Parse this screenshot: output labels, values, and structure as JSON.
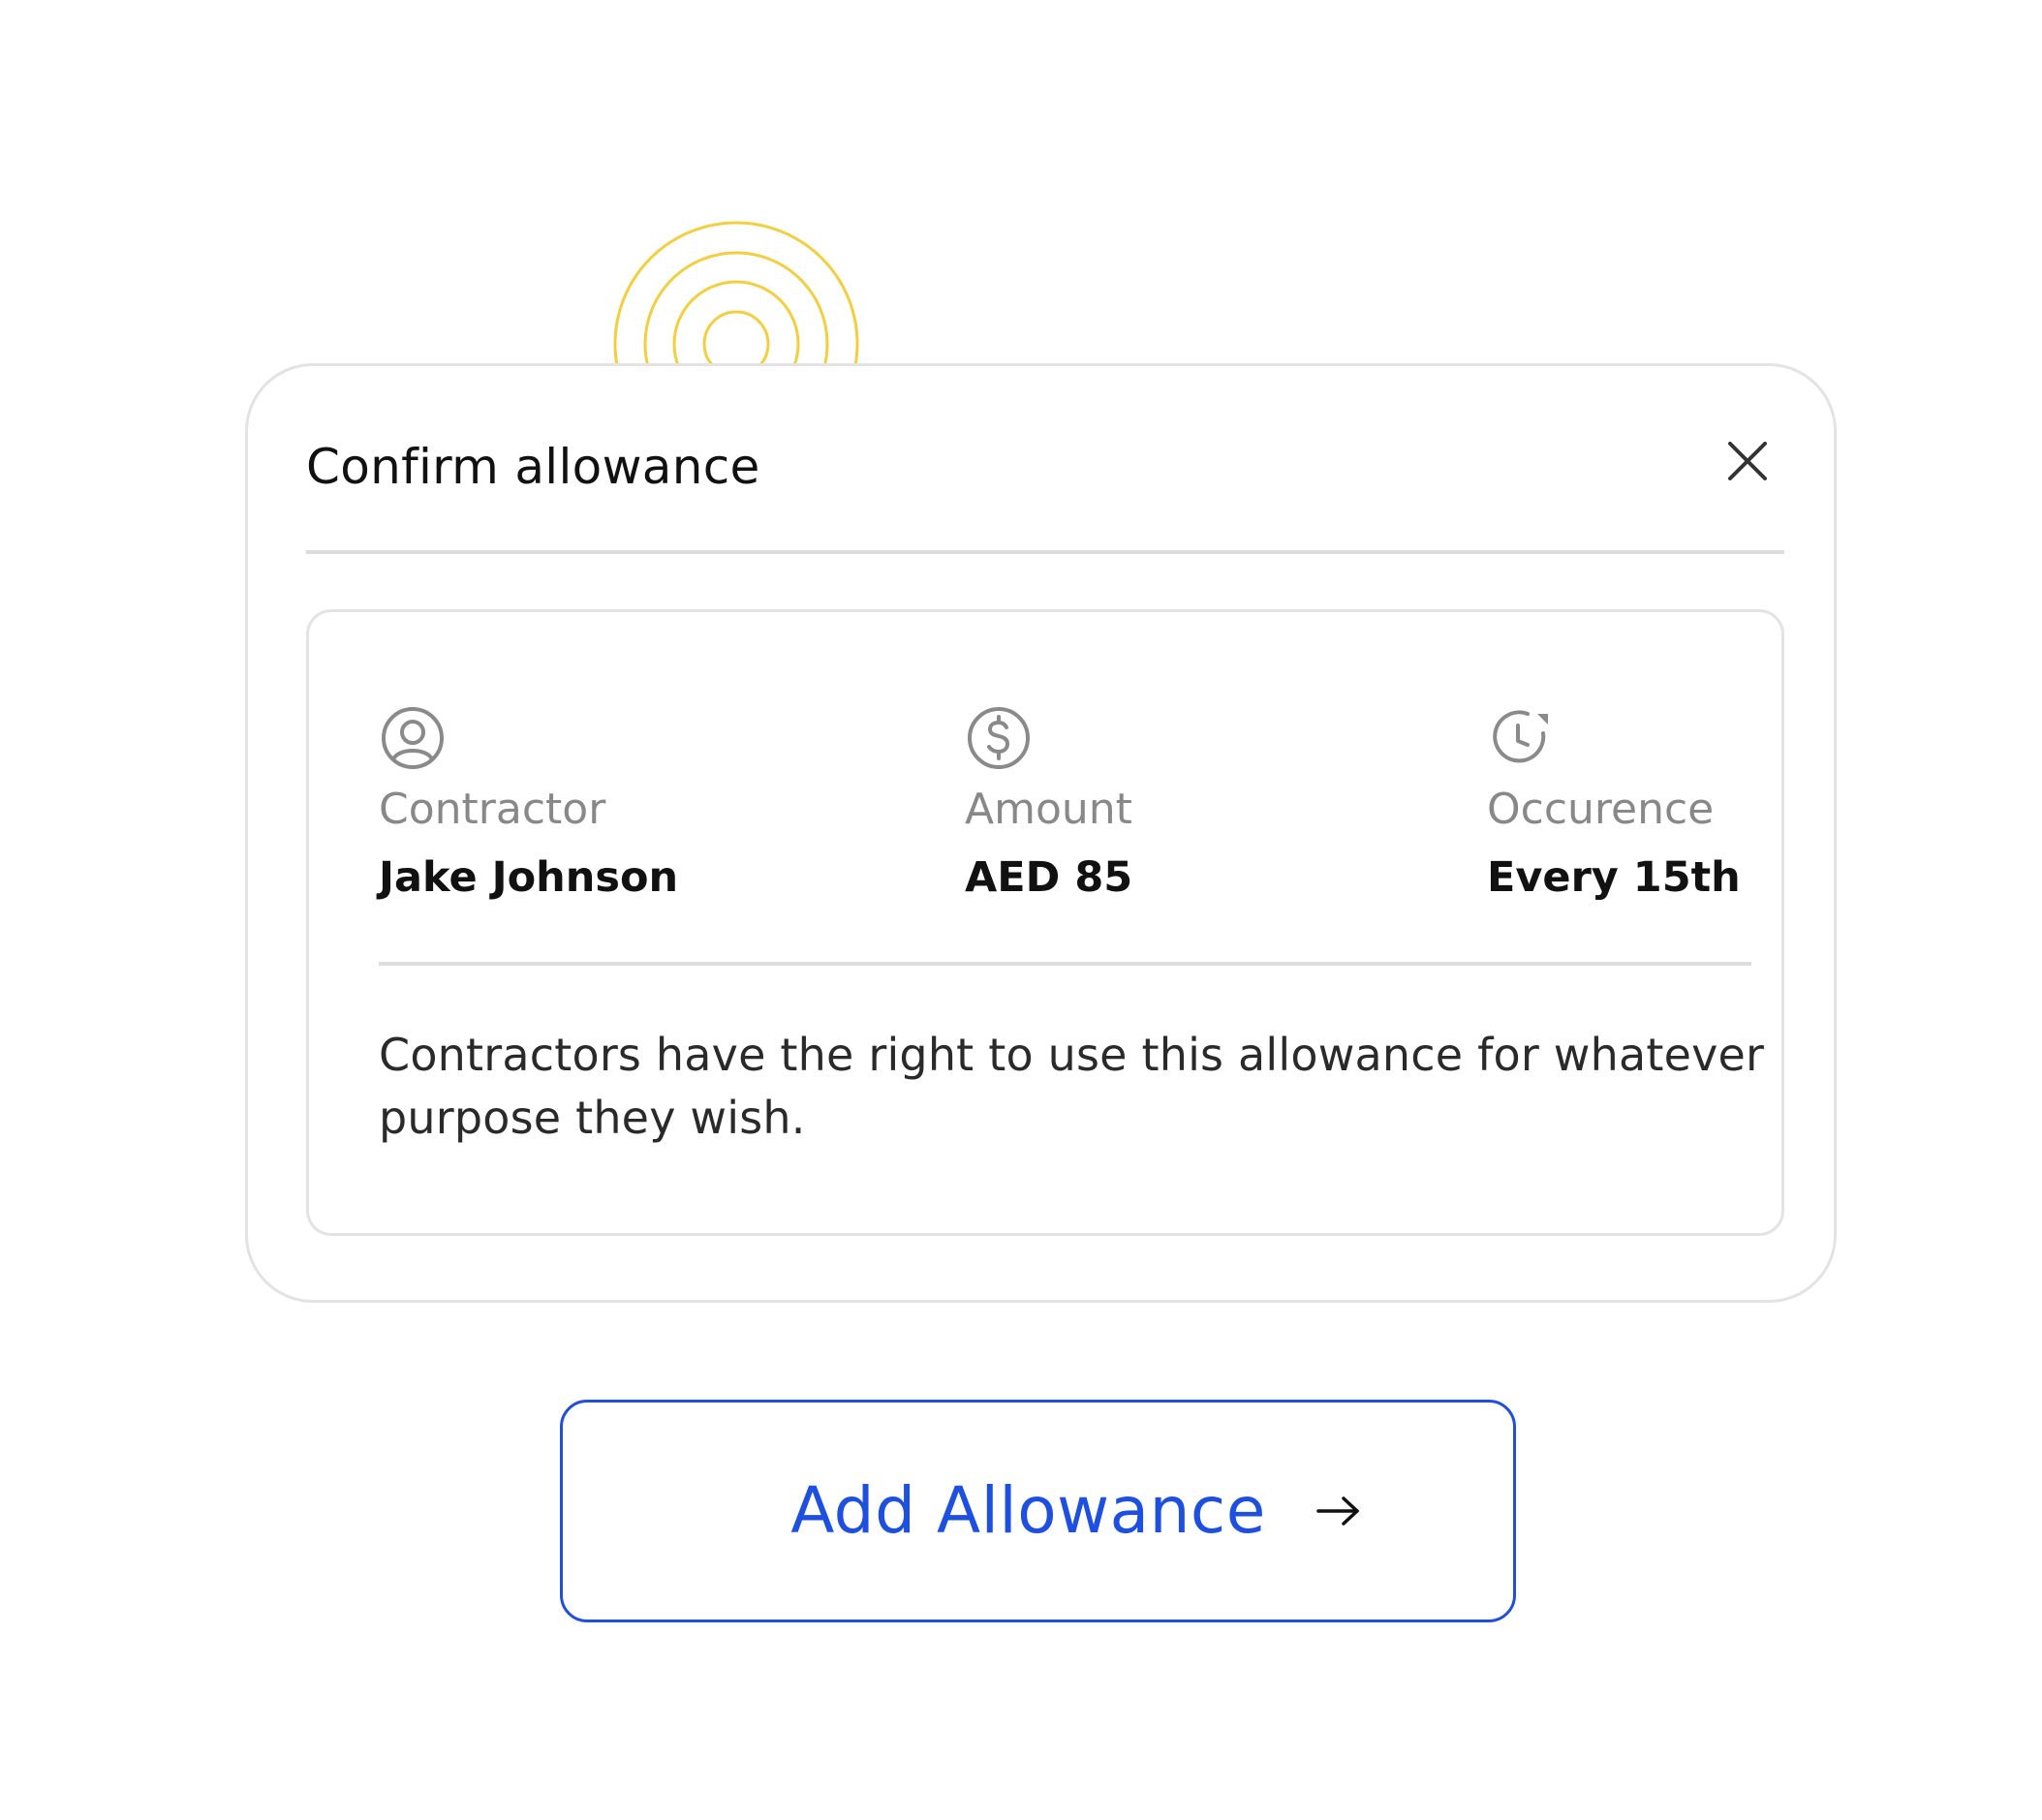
{
  "dialog": {
    "title": "Confirm allowance",
    "close_icon": "close-icon"
  },
  "details": [
    {
      "icon": "user-circle-icon",
      "label": "Contractor",
      "value": "Jake Johnson"
    },
    {
      "icon": "dollar-circle-icon",
      "label": "Amount",
      "value": "AED 85"
    },
    {
      "icon": "clock-recurring-icon",
      "label": "Occurence",
      "value": "Every 15th"
    }
  ],
  "description": "Contractors have the right to use this allowance for whatever purpose they wish.",
  "action": {
    "label": "Add Allowance",
    "icon": "arrow-right-icon"
  },
  "colors": {
    "accent": "#1d4fe0",
    "decoration": "#f3cf3f",
    "muted_text": "#888888",
    "border": "#e3e3e3"
  }
}
